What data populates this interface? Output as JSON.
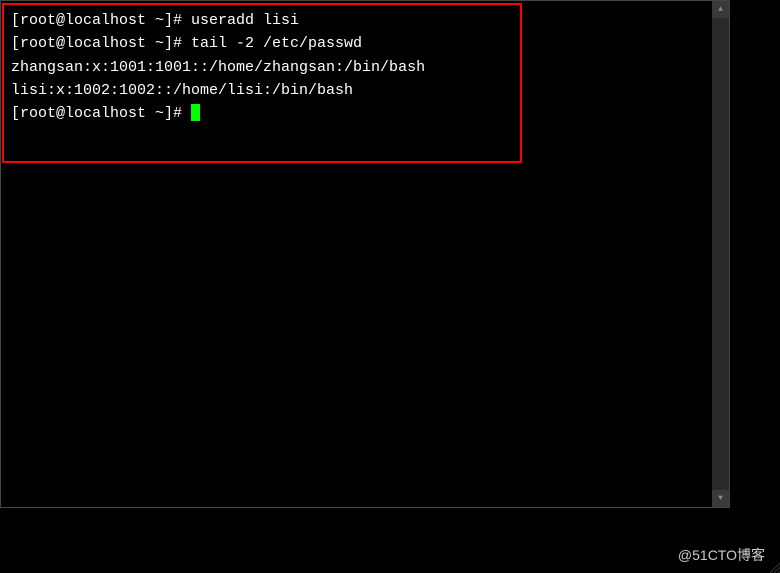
{
  "terminal": {
    "lines": [
      {
        "prompt": "[root@localhost ~]# ",
        "command": "useradd lisi"
      },
      {
        "prompt": "[root@localhost ~]# ",
        "command": "tail -2 /etc/passwd"
      },
      {
        "output": "zhangsan:x:1001:1001::/home/zhangsan:/bin/bash"
      },
      {
        "output": "lisi:x:1002:1002::/home/lisi:/bin/bash"
      },
      {
        "prompt": "[root@localhost ~]# ",
        "cursor": true
      }
    ]
  },
  "watermark": "@51CTO博客",
  "colors": {
    "background": "#000000",
    "text": "#ffffff",
    "cursor": "#00ff00",
    "highlight_border": "#ff0000"
  }
}
